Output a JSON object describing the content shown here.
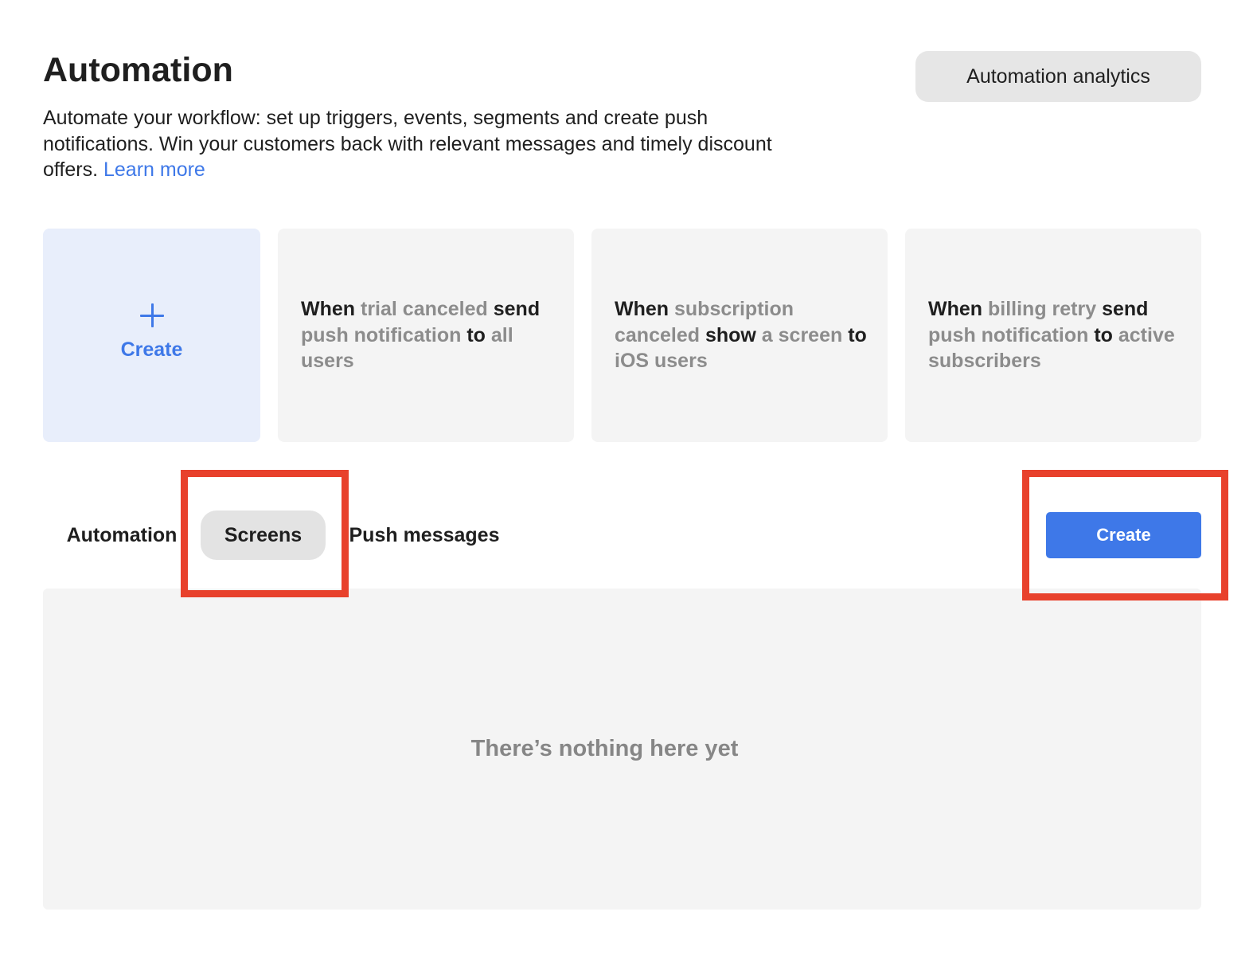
{
  "header": {
    "title": "Automation",
    "analytics_button": "Automation analytics",
    "description": "Automate your workflow: set up triggers, events, segments and create push notifications. Win your customers back with relevant messages and timely discount offers.",
    "learn_more": "Learn more"
  },
  "cards": {
    "create_label": "Create",
    "templates": [
      {
        "parts": [
          {
            "text": "When ",
            "style": "strong"
          },
          {
            "text": "trial canceled ",
            "style": "muted"
          },
          {
            "text": "send ",
            "style": "strong"
          },
          {
            "text": "push notification ",
            "style": "muted"
          },
          {
            "text": "to ",
            "style": "strong"
          },
          {
            "text": "all users",
            "style": "muted"
          }
        ]
      },
      {
        "parts": [
          {
            "text": "When ",
            "style": "strong"
          },
          {
            "text": "subscription canceled ",
            "style": "muted"
          },
          {
            "text": "show ",
            "style": "strong"
          },
          {
            "text": "a screen ",
            "style": "muted"
          },
          {
            "text": "to ",
            "style": "strong"
          },
          {
            "text": "iOS users",
            "style": "muted"
          }
        ]
      },
      {
        "parts": [
          {
            "text": "When ",
            "style": "strong"
          },
          {
            "text": "billing retry ",
            "style": "muted"
          },
          {
            "text": "send ",
            "style": "strong"
          },
          {
            "text": "push notification ",
            "style": "muted"
          },
          {
            "text": "to ",
            "style": "strong"
          },
          {
            "text": "active subscribers",
            "style": "muted"
          }
        ]
      }
    ]
  },
  "tabs": {
    "items": [
      "Automation",
      "Screens",
      "Push messages"
    ],
    "selected": "Screens"
  },
  "toolbar": {
    "create_label": "Create"
  },
  "empty_state": {
    "message": "There’s nothing here yet"
  },
  "colors": {
    "accent": "#3e78e8",
    "highlight": "#e8412c",
    "muted_text": "#8c8c8c"
  }
}
